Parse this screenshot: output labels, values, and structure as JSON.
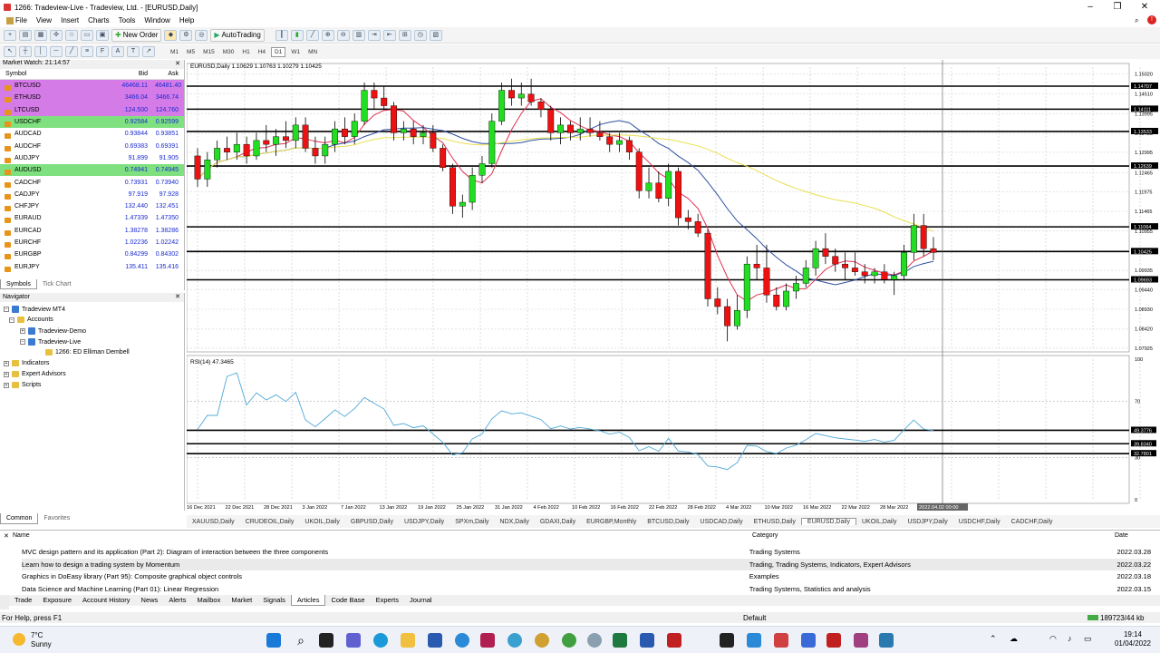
{
  "window": {
    "title": "1266: Tradeview-Live - Tradeview, Ltd. - [EURUSD,Daily]"
  },
  "menu": [
    "File",
    "View",
    "Insert",
    "Charts",
    "Tools",
    "Window",
    "Help"
  ],
  "toolbar": {
    "new_order": "New Order",
    "autotrading": "AutoTrading"
  },
  "timeframes": [
    "M1",
    "M5",
    "M15",
    "M30",
    "H1",
    "H4",
    "D1",
    "W1",
    "MN"
  ],
  "active_timeframe": "D1",
  "market_watch": {
    "title": "Market Watch: 21:14:57",
    "columns": [
      "Symbol",
      "Bid",
      "Ask"
    ],
    "rows": [
      {
        "s": "BTCUSD",
        "b": "46468.11",
        "a": "46481.40",
        "hl": "purple"
      },
      {
        "s": "ETHUSD",
        "b": "3466.04",
        "a": "3466.74",
        "hl": "purple"
      },
      {
        "s": "LTCUSD",
        "b": "124.500",
        "a": "124.760",
        "hl": "purple"
      },
      {
        "s": "USDCHF",
        "b": "0.92584",
        "a": "0.92599",
        "hl": "green"
      },
      {
        "s": "AUDCAD",
        "b": "0.93844",
        "a": "0.93851",
        "hl": ""
      },
      {
        "s": "AUDCHF",
        "b": "0.69383",
        "a": "0.69391",
        "hl": ""
      },
      {
        "s": "AUDJPY",
        "b": "91.899",
        "a": "91.905",
        "hl": ""
      },
      {
        "s": "AUDUSD",
        "b": "0.74941",
        "a": "0.74945",
        "hl": "green"
      },
      {
        "s": "CADCHF",
        "b": "0.73931",
        "a": "0.73940",
        "hl": ""
      },
      {
        "s": "CADJPY",
        "b": "97.919",
        "a": "97.928",
        "hl": ""
      },
      {
        "s": "CHFJPY",
        "b": "132.440",
        "a": "132.451",
        "hl": ""
      },
      {
        "s": "EURAUD",
        "b": "1.47339",
        "a": "1.47350",
        "hl": ""
      },
      {
        "s": "EURCAD",
        "b": "1.38278",
        "a": "1.38286",
        "hl": ""
      },
      {
        "s": "EURCHF",
        "b": "1.02236",
        "a": "1.02242",
        "hl": ""
      },
      {
        "s": "EURGBP",
        "b": "0.84299",
        "a": "0.84302",
        "hl": ""
      },
      {
        "s": "EURJPY",
        "b": "135.411",
        "a": "135.416",
        "hl": ""
      }
    ],
    "tabs": [
      "Symbols",
      "Tick Chart"
    ]
  },
  "navigator": {
    "title": "Navigator",
    "items": [
      "Tradeview MT4",
      "Accounts",
      "Tradeview-Demo",
      "Tradeview-Live",
      "1266: ED Elliman Dembell",
      "Indicators",
      "Expert Advisors",
      "Scripts"
    ],
    "tabs": [
      "Common",
      "Favorites"
    ]
  },
  "chart": {
    "label": "EURUSD,Daily  1.10629 1.10763 1.10279 1.10425",
    "rsi_label": "RSI(14) 47.3465",
    "price_ticks": [
      "1.15020",
      "1.14510",
      "1.13995",
      "1.13485",
      "1.12995",
      "1.12465",
      "1.11975",
      "1.11465",
      "1.10955",
      "1.10445",
      "1.09935",
      "1.09440",
      "1.08930",
      "1.08420",
      "1.07925"
    ],
    "hline_labels": [
      "1.14707",
      "1.14111",
      "1.13533",
      "1.12639",
      "1.11064",
      "1.10425",
      "1.09693"
    ],
    "rsi_ticks": [
      "100",
      "70",
      "50",
      "30",
      "0"
    ],
    "rsi_hline_labels": [
      "49.3776",
      "39.8340",
      "32.7801"
    ],
    "date_labels": [
      "16 Dec 2021",
      "22 Dec 2021",
      "28 Dec 2021",
      "3 Jan 2022",
      "7 Jan 2022",
      "13 Jan 2022",
      "19 Jan 2022",
      "25 Jan 2022",
      "31 Jan 2022",
      "4 Feb 2022",
      "10 Feb 2022",
      "16 Feb 2022",
      "22 Feb 2022",
      "28 Feb 2022",
      "4 Mar 2022",
      "10 Mar 2022",
      "16 Mar 2022",
      "22 Mar 2022",
      "28 Mar 2022"
    ],
    "cursor_date": "2022.04.02 00:00"
  },
  "chart_data": {
    "type": "candlestick",
    "symbol": "EURUSD",
    "timeframe": "Daily",
    "ylim": [
      1.0792,
      1.152
    ],
    "candles": [
      [
        1.129,
        1.131,
        1.121,
        1.123
      ],
      [
        1.123,
        1.13,
        1.121,
        1.128
      ],
      [
        1.128,
        1.133,
        1.126,
        1.131
      ],
      [
        1.131,
        1.134,
        1.128,
        1.13
      ],
      [
        1.13,
        1.135,
        1.128,
        1.132
      ],
      [
        1.132,
        1.134,
        1.127,
        1.129
      ],
      [
        1.129,
        1.135,
        1.128,
        1.133
      ],
      [
        1.133,
        1.137,
        1.13,
        1.132
      ],
      [
        1.132,
        1.136,
        1.129,
        1.134
      ],
      [
        1.134,
        1.138,
        1.131,
        1.133
      ],
      [
        1.133,
        1.139,
        1.131,
        1.137
      ],
      [
        1.137,
        1.139,
        1.13,
        1.131
      ],
      [
        1.131,
        1.134,
        1.127,
        1.129
      ],
      [
        1.129,
        1.134,
        1.127,
        1.132
      ],
      [
        1.132,
        1.138,
        1.13,
        1.136
      ],
      [
        1.136,
        1.139,
        1.132,
        1.134
      ],
      [
        1.134,
        1.14,
        1.132,
        1.138
      ],
      [
        1.138,
        1.148,
        1.137,
        1.146
      ],
      [
        1.146,
        1.148,
        1.141,
        1.144
      ],
      [
        1.144,
        1.147,
        1.141,
        1.142
      ],
      [
        1.142,
        1.143,
        1.133,
        1.135
      ],
      [
        1.135,
        1.138,
        1.133,
        1.136
      ],
      [
        1.136,
        1.138,
        1.132,
        1.134
      ],
      [
        1.134,
        1.137,
        1.132,
        1.135
      ],
      [
        1.135,
        1.137,
        1.13,
        1.131
      ],
      [
        1.131,
        1.132,
        1.125,
        1.126
      ],
      [
        1.126,
        1.127,
        1.114,
        1.116
      ],
      [
        1.116,
        1.119,
        1.113,
        1.117
      ],
      [
        1.117,
        1.126,
        1.115,
        1.124
      ],
      [
        1.124,
        1.129,
        1.122,
        1.127
      ],
      [
        1.127,
        1.14,
        1.126,
        1.138
      ],
      [
        1.138,
        1.148,
        1.137,
        1.146
      ],
      [
        1.146,
        1.149,
        1.142,
        1.144
      ],
      [
        1.144,
        1.148,
        1.142,
        1.145
      ],
      [
        1.145,
        1.149,
        1.142,
        1.143
      ],
      [
        1.143,
        1.144,
        1.139,
        1.141
      ],
      [
        1.141,
        1.142,
        1.133,
        1.135
      ],
      [
        1.135,
        1.139,
        1.132,
        1.137
      ],
      [
        1.137,
        1.138,
        1.133,
        1.135
      ],
      [
        1.135,
        1.139,
        1.133,
        1.136
      ],
      [
        1.136,
        1.139,
        1.134,
        1.135
      ],
      [
        1.135,
        1.138,
        1.133,
        1.134
      ],
      [
        1.134,
        1.135,
        1.13,
        1.132
      ],
      [
        1.132,
        1.135,
        1.13,
        1.133
      ],
      [
        1.133,
        1.134,
        1.128,
        1.13
      ],
      [
        1.13,
        1.131,
        1.118,
        1.12
      ],
      [
        1.12,
        1.126,
        1.118,
        1.122
      ],
      [
        1.122,
        1.125,
        1.117,
        1.118
      ],
      [
        1.118,
        1.127,
        1.116,
        1.125
      ],
      [
        1.125,
        1.126,
        1.111,
        1.113
      ],
      [
        1.113,
        1.115,
        1.11,
        1.112
      ],
      [
        1.112,
        1.114,
        1.108,
        1.109
      ],
      [
        1.109,
        1.11,
        1.09,
        1.092
      ],
      [
        1.092,
        1.095,
        1.088,
        1.09
      ],
      [
        1.09,
        1.092,
        1.081,
        1.085
      ],
      [
        1.085,
        1.093,
        1.084,
        1.089
      ],
      [
        1.089,
        1.103,
        1.087,
        1.101
      ],
      [
        1.101,
        1.106,
        1.097,
        1.1
      ],
      [
        1.1,
        1.106,
        1.091,
        1.093
      ],
      [
        1.093,
        1.095,
        1.089,
        1.09
      ],
      [
        1.09,
        1.096,
        1.089,
        1.094
      ],
      [
        1.094,
        1.098,
        1.092,
        1.096
      ],
      [
        1.096,
        1.102,
        1.095,
        1.1
      ],
      [
        1.1,
        1.107,
        1.098,
        1.105
      ],
      [
        1.105,
        1.109,
        1.101,
        1.103
      ],
      [
        1.103,
        1.105,
        1.099,
        1.101
      ],
      [
        1.101,
        1.104,
        1.097,
        1.1
      ],
      [
        1.1,
        1.104,
        1.098,
        1.099
      ],
      [
        1.099,
        1.101,
        1.096,
        1.098
      ],
      [
        1.098,
        1.1,
        1.096,
        1.099
      ],
      [
        1.099,
        1.101,
        1.096,
        1.097
      ],
      [
        1.097,
        1.099,
        1.093,
        1.098
      ],
      [
        1.098,
        1.106,
        1.097,
        1.104
      ],
      [
        1.104,
        1.114,
        1.102,
        1.111
      ],
      [
        1.111,
        1.114,
        1.103,
        1.105
      ],
      [
        1.105,
        1.108,
        1.102,
        1.104
      ]
    ],
    "rsi_ylim": [
      0,
      100
    ],
    "rsi_levels": [
      49.3776,
      39.834,
      32.7801
    ],
    "rsi_last": 47.3465
  },
  "chart_tabs": [
    "XAUUSD,Daily",
    "CRUDEOIL,Daily",
    "UKOIL,Daily",
    "GBPUSD,Daily",
    "USDJPY,Daily",
    "SPXm,Daily",
    "NDX,Daily",
    "GDAXI,Daily",
    "EURGBP,Monthly",
    "BTCUSD,Daily",
    "USDCAD,Daily",
    "ETHUSD,Daily",
    "EURUSD,Daily",
    "UKOIL,Daily",
    "USDJPY,Daily",
    "USDCHF,Daily",
    "CADCHF,Daily"
  ],
  "active_chart_tab": "EURUSD,Daily",
  "terminal": {
    "columns": [
      "Name",
      "Category",
      "Date"
    ],
    "rows": [
      {
        "name": "MVC design pattern and its application (Part 2): Diagram of interaction between the three components",
        "cat": "Trading Systems",
        "date": "2022.03.28"
      },
      {
        "name": "Learn how to design a trading system by Momentum",
        "cat": "Trading, Trading Systems, Indicators, Expert Advisors",
        "date": "2022.03.22"
      },
      {
        "name": "Graphics in DoEasy library (Part 95): Composite graphical object controls",
        "cat": "Examples",
        "date": "2022.03.18"
      },
      {
        "name": "Data Science and Machine Learning (Part 01): Linear Regression",
        "cat": "Trading Systems, Statistics and analysis",
        "date": "2022.03.15"
      }
    ],
    "tabs": [
      "Trade",
      "Exposure",
      "Account History",
      "News",
      "Alerts",
      "Mailbox",
      "Market",
      "Signals",
      "Articles",
      "Code Base",
      "Experts",
      "Journal"
    ],
    "active_tab": "Articles",
    "side_label": "Terminal"
  },
  "status": {
    "help": "For Help, press F1",
    "profile": "Default",
    "traffic": "189723/44 kb"
  },
  "taskbar": {
    "temp": "7°C",
    "weather": "Sunny",
    "time": "19:14",
    "date": "01/04/2022"
  }
}
